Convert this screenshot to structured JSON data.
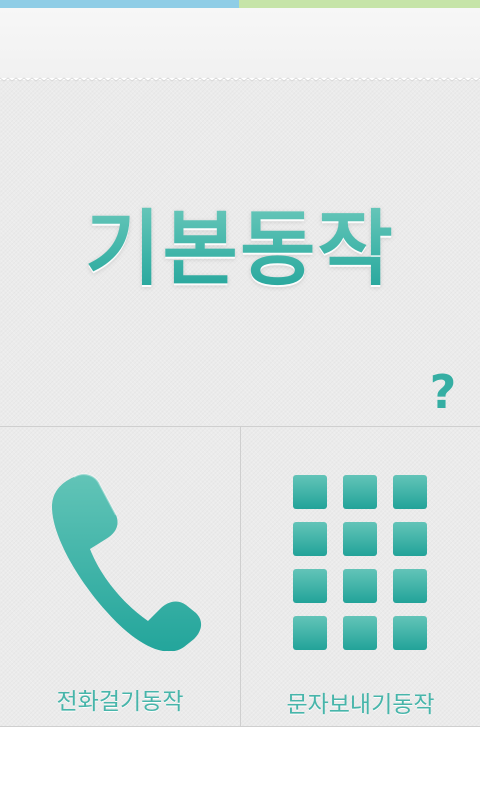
{
  "header": {
    "strip_colors": [
      "#8fcde6",
      "#c6e4a8"
    ]
  },
  "main": {
    "title": "기본동작",
    "help_label": "?",
    "accent_color": "#35aea3"
  },
  "tiles": [
    {
      "label": "전화걸기동작",
      "icon": "phone-handset-icon"
    },
    {
      "label": "문자보내기동작",
      "icon": "keypad-grid-icon"
    }
  ]
}
